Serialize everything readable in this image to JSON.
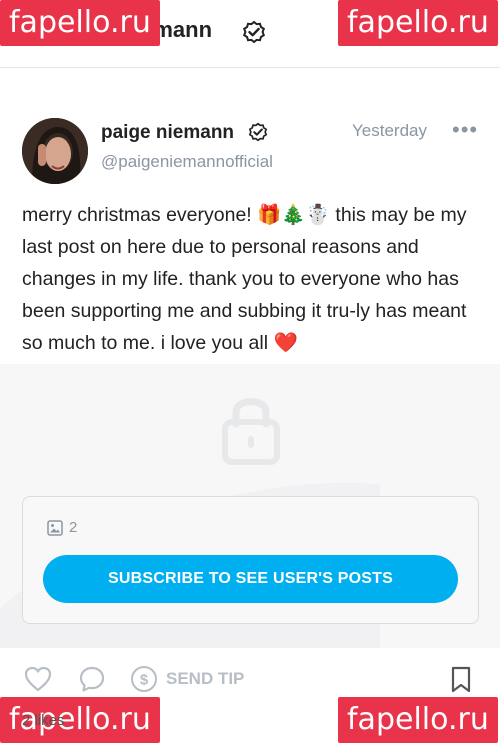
{
  "header": {
    "back_label": "←",
    "title": "paige niemann",
    "menu_label": "⋮"
  },
  "watermarks": [
    "fapello.ru",
    "fapello.ru",
    "fapello.ru",
    "fapello.ru"
  ],
  "post": {
    "author_name": "paige niemann",
    "author_handle": "@paigeniemannofficial",
    "timestamp": "Yesterday",
    "more_label": "•••",
    "text": "merry christmas everyone! 🎁🎄☃️ this may be my last post on here due to personal reasons and changes in my life. thank you to everyone who has been supporting me and subbing it tru-ly has meant so much to me. i love you all ❤️"
  },
  "locked": {
    "media_count": "2",
    "subscribe_label": "SUBSCRIBE TO SEE USER'S POSTS"
  },
  "actions": {
    "send_tip_label": "SEND TIP"
  },
  "footer": {
    "likes": "2 likes"
  },
  "colors": {
    "accent": "#00aff0",
    "watermark": "#e8334a",
    "muted": "#8a96a3"
  },
  "icons": [
    "back-arrow-icon",
    "verified-icon",
    "more-icon",
    "lock-icon",
    "image-icon",
    "heart-icon",
    "comment-icon",
    "dollar-icon",
    "bookmark-icon"
  ]
}
